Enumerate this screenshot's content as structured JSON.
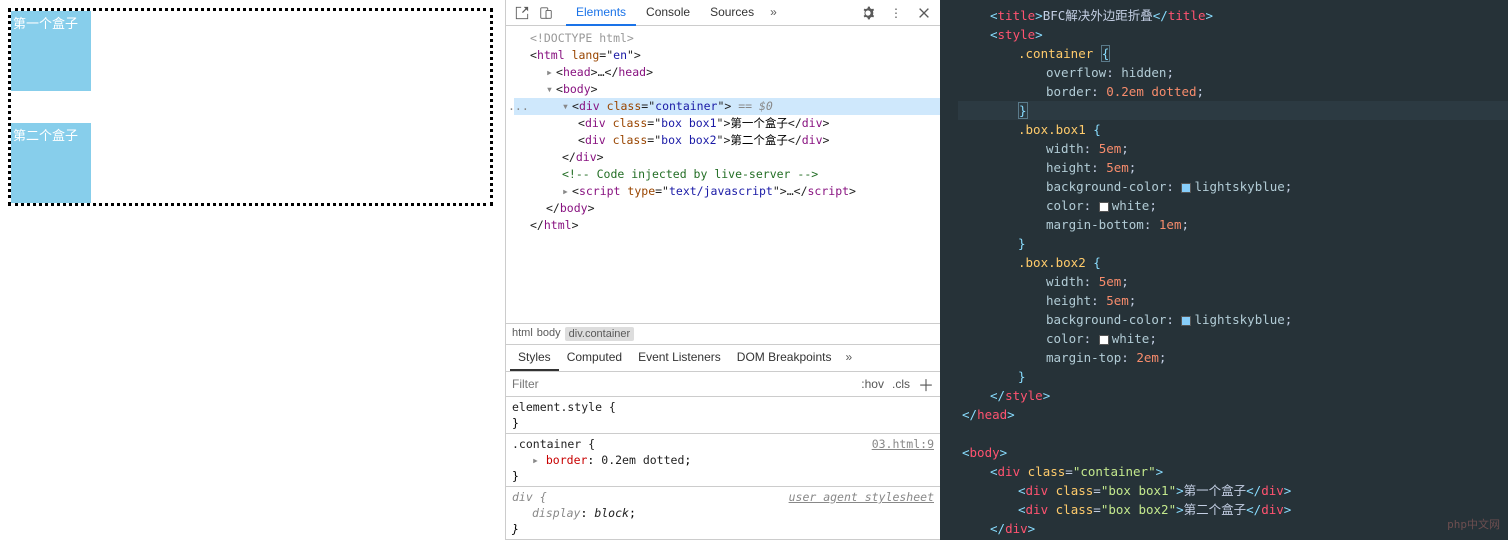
{
  "preview": {
    "box1_text": "第一个盒子",
    "box2_text": "第二个盒子"
  },
  "devtools": {
    "tabs": [
      "Elements",
      "Console",
      "Sources"
    ],
    "activeTab": "Elements",
    "dom": {
      "doctype": "<!DOCTYPE html>",
      "html_open": "html",
      "html_lang": "lang",
      "html_lang_val": "en",
      "head_open": "head",
      "head_ellipsis": "…",
      "body_open": "body",
      "div_container": "div",
      "class_attr": "class",
      "container_class": "container",
      "eq_dollar": "== $0",
      "box1_class": "box box1",
      "box1_text": "第一个盒子",
      "box2_class": "box box2",
      "box2_text": "第二个盒子",
      "comment": "<!-- Code injected by live-server -->",
      "script_tag": "script",
      "script_type_attr": "type",
      "script_type_val": "text/javascript",
      "script_ellipsis": "…"
    },
    "breadcrumb": [
      "html",
      "body",
      "div.container"
    ],
    "stylesTabs": [
      "Styles",
      "Computed",
      "Event Listeners",
      "DOM Breakpoints"
    ],
    "activeStylesTab": "Styles",
    "filter_placeholder": "Filter",
    "filter_hov": ":hov",
    "filter_cls": ".cls",
    "styles": {
      "element_style": "element.style {",
      "container_sel": ".container {",
      "container_source": "03.html:9",
      "border_prop": "border",
      "border_val": "0.2em dotted",
      "div_sel": "div {",
      "div_source": "user agent stylesheet",
      "display_prop": "display",
      "display_val": "block"
    }
  },
  "editor": {
    "lines": {
      "title_text": "BFC解决外边距折叠",
      "container_sel": ".container",
      "overflow_val": "hidden",
      "border_val": "0.2em dotted",
      "box1_sel": ".box.box1",
      "box2_sel": ".box.box2",
      "width_val": "5em",
      "height_val": "5em",
      "bg_val": "lightskyblue",
      "color_val": "white",
      "mb_val": "1em",
      "mt_val": "2em",
      "container_class": "container",
      "box1_class": "box box1",
      "box1_text": "第一个盒子",
      "box2_class": "box box2",
      "box2_text": "第二个盒子"
    },
    "watermark": "php中文网"
  }
}
